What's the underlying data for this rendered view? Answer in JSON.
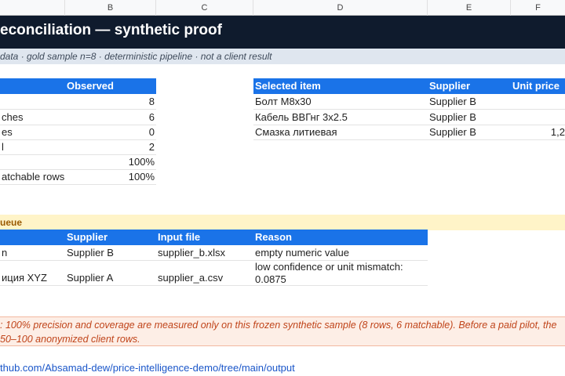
{
  "columns": [
    "B",
    "C",
    "D",
    "E",
    "F"
  ],
  "title": "econciliation — synthetic proof",
  "subtitle": "data · gold sample n=8 · deterministic pipeline · not a client result",
  "metrics": {
    "header": "Observed",
    "rows": [
      {
        "label": "",
        "value": "8"
      },
      {
        "label": "ches",
        "value": "6"
      },
      {
        "label": "es",
        "value": "0"
      },
      {
        "label": "l",
        "value": "2"
      },
      {
        "label": "",
        "value": "100%"
      },
      {
        "label": "atchable rows",
        "value": "100%"
      }
    ]
  },
  "selected": {
    "headers": [
      "Selected item",
      "Supplier",
      "Unit price"
    ],
    "rows": [
      {
        "item": "Болт М8х30",
        "supplier": "Supplier B",
        "price": ""
      },
      {
        "item": "Кабель ВВГнг 3х2.5",
        "supplier": "Supplier B",
        "price": ""
      },
      {
        "item": "Смазка литиевая",
        "supplier": "Supplier B",
        "price": "1,2"
      }
    ]
  },
  "queue": {
    "title": "ueue",
    "headers": [
      "Supplier",
      "Input file",
      "Reason"
    ],
    "rows": [
      {
        "item": "n",
        "supplier": "Supplier B",
        "file": "supplier_b.xlsx",
        "reason": [
          "empty numeric value"
        ]
      },
      {
        "item": "иция XYZ",
        "supplier": "Supplier A",
        "file": "supplier_a.csv",
        "reason": [
          "low confidence or unit mismatch:",
          "0.0875"
        ]
      }
    ]
  },
  "note": {
    "line1": ": 100% precision and coverage are measured only on this frozen synthetic sample (8 rows, 6 matchable). Before a paid pilot, the",
    "line2": "50–100 anonymized client rows."
  },
  "link": "thub.com/Absamad-dew/price-intelligence-demo/tree/main/output"
}
